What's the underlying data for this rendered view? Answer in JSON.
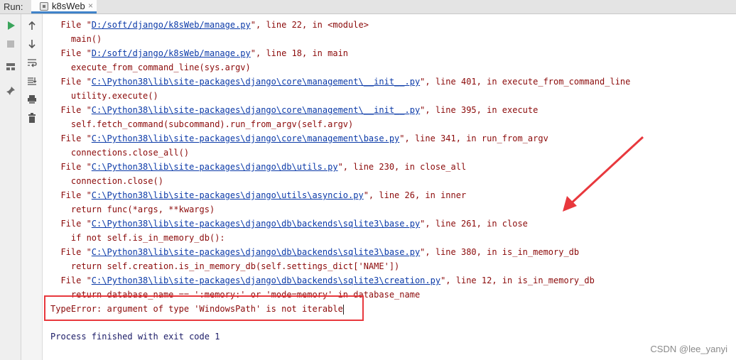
{
  "header": {
    "run_label": "Run:",
    "tab_title": "k8sWeb",
    "tab_close": "×"
  },
  "toolbar": {
    "left": [
      "play-icon",
      "stop-icon",
      "layout-icon",
      "pin-icon"
    ],
    "right": [
      "up-arrow-icon",
      "down-arrow-icon",
      "soft-wrap-icon",
      "scroll-to-end-icon",
      "print-icon",
      "trash-icon"
    ]
  },
  "traceback": [
    {
      "pre": "  File \"",
      "link": "D:/soft/django/k8sWeb/manage.py",
      "post": "\", line 22, in <module>"
    },
    {
      "code": "    main()"
    },
    {
      "pre": "  File \"",
      "link": "D:/soft/django/k8sWeb/manage.py",
      "post": "\", line 18, in main"
    },
    {
      "code": "    execute_from_command_line(sys.argv)"
    },
    {
      "pre": "  File \"",
      "link": "C:\\Python38\\lib\\site-packages\\django\\core\\management\\__init__.py",
      "post": "\", line 401, in execute_from_command_line"
    },
    {
      "code": "    utility.execute()"
    },
    {
      "pre": "  File \"",
      "link": "C:\\Python38\\lib\\site-packages\\django\\core\\management\\__init__.py",
      "post": "\", line 395, in execute"
    },
    {
      "code": "    self.fetch_command(subcommand).run_from_argv(self.argv)"
    },
    {
      "pre": "  File \"",
      "link": "C:\\Python38\\lib\\site-packages\\django\\core\\management\\base.py",
      "post": "\", line 341, in run_from_argv"
    },
    {
      "code": "    connections.close_all()"
    },
    {
      "pre": "  File \"",
      "link": "C:\\Python38\\lib\\site-packages\\django\\db\\utils.py",
      "post": "\", line 230, in close_all"
    },
    {
      "code": "    connection.close()"
    },
    {
      "pre": "  File \"",
      "link": "C:\\Python38\\lib\\site-packages\\django\\utils\\asyncio.py",
      "post": "\", line 26, in inner"
    },
    {
      "code": "    return func(*args, **kwargs)"
    },
    {
      "pre": "  File \"",
      "link": "C:\\Python38\\lib\\site-packages\\django\\db\\backends\\sqlite3\\base.py",
      "post": "\", line 261, in close"
    },
    {
      "code": "    if not self.is_in_memory_db():"
    },
    {
      "pre": "  File \"",
      "link": "C:\\Python38\\lib\\site-packages\\django\\db\\backends\\sqlite3\\base.py",
      "post": "\", line 380, in is_in_memory_db"
    },
    {
      "code": "    return self.creation.is_in_memory_db(self.settings_dict['NAME'])"
    },
    {
      "pre": "  File \"",
      "link": "C:\\Python38\\lib\\site-packages\\django\\db\\backends\\sqlite3\\creation.py",
      "post": "\", line 12, in is_in_memory_db"
    },
    {
      "code": "    return database_name == ':memory:' or 'mode=memory' in database_name"
    }
  ],
  "error": "TypeError: argument of type 'WindowsPath' is not iterable",
  "process": "Process finished with exit code 1",
  "watermark": "CSDN @lee_yanyi",
  "colors": {
    "error_text": "#8b0a0a",
    "link": "#0b3aa8",
    "output_text": "#1a1a66",
    "highlight": "#e8383d",
    "run_green": "#3ba55c"
  }
}
